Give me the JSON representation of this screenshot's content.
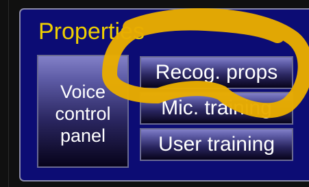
{
  "panel": {
    "title": "Properties"
  },
  "buttons": {
    "voice_control_panel": "Voice\ncontrol\npanel",
    "recog_props": "Recog. props",
    "mic_training": "Mic. training",
    "user_training": "User training"
  },
  "colors": {
    "panel_background": "#0c0c74",
    "title_text": "#f0d000",
    "annotation_marker": "#e8ac00"
  }
}
